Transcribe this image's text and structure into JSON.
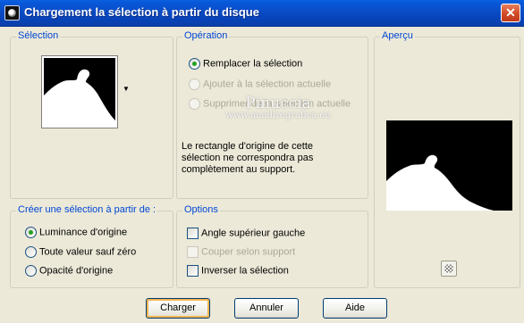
{
  "window": {
    "title": "Chargement la sélection à partir du disque",
    "close_label": "✕"
  },
  "selection_group": {
    "title": "Sélection"
  },
  "operation_group": {
    "title": "Opération",
    "options": [
      {
        "label": "Remplacer la sélection",
        "checked": true,
        "disabled": false
      },
      {
        "label": "Ajouter à la sélection actuelle",
        "checked": false,
        "disabled": true
      },
      {
        "label": "Supprimer de la sélection actuelle",
        "checked": false,
        "disabled": true
      }
    ],
    "info": "Le rectangle d'origine de cette sélection ne correspondra pas complètement au support."
  },
  "watermark": {
    "name": "Pinuccia",
    "url": "www.maidiregrafica.eu"
  },
  "preview_group": {
    "title": "Aperçu"
  },
  "create_group": {
    "title": "Créer une sélection à partir de :",
    "options": [
      {
        "label": "Luminance d'origine",
        "checked": true
      },
      {
        "label": "Toute valeur sauf zéro",
        "checked": false
      },
      {
        "label": "Opacité d'origine",
        "checked": false
      }
    ]
  },
  "options_group": {
    "title": "Options",
    "checks": [
      {
        "label": "Angle supérieur gauche",
        "checked": false,
        "disabled": false
      },
      {
        "label": "Couper selon support",
        "checked": false,
        "disabled": true
      },
      {
        "label": "Inverser la sélection",
        "checked": false,
        "disabled": false
      }
    ]
  },
  "buttons": {
    "load": "Charger",
    "cancel": "Annuler",
    "help": "Aide"
  },
  "colors": {
    "accent": "#0046d5",
    "titlebar": "#0a4cc6",
    "dialog_bg": "#ece9d8",
    "radio_dot": "#21a121",
    "default_button_ring": "#f2b54f"
  }
}
